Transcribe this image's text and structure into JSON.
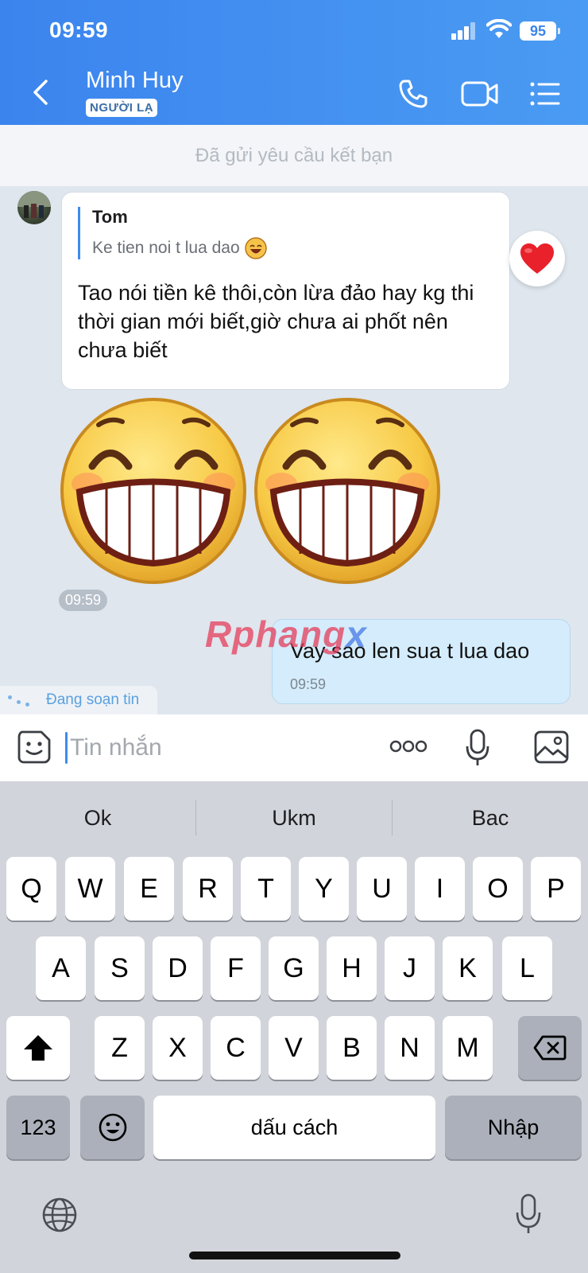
{
  "status_bar": {
    "time": "09:59",
    "battery": "95"
  },
  "header": {
    "contact_name": "Minh Huy",
    "badge": "NGƯỜI LẠ",
    "icons": [
      "back-icon",
      "phone-icon",
      "video-call-icon",
      "menu-list-icon"
    ]
  },
  "friend_banner": "Đã gửi yêu cầu kết bạn",
  "messages": {
    "incoming": {
      "quote_author": "Tom",
      "quote_text": "Ke tien noi t lua dao",
      "text": "Tao nói tiền kê thôi,còn lừa đảo hay kg thi thời gian mới biết,giờ chưa ai phốt nên chưa biết",
      "reaction": "heart-icon",
      "stickers": [
        "grinning-face-sticker",
        "grinning-face-sticker"
      ],
      "time": "09:59"
    },
    "outgoing": {
      "text": "Vay sao len sua t lua dao",
      "time": "09:59"
    }
  },
  "watermark": {
    "part1": "Rphang",
    "part2": "x"
  },
  "typing_indicator": "Đang soạn tin",
  "composer": {
    "placeholder": "Tin nhắn",
    "icons": [
      "sticker-icon",
      "more-icon",
      "microphone-icon",
      "image-icon"
    ]
  },
  "keyboard": {
    "suggestions": [
      "Ok",
      "Ukm",
      "Bac"
    ],
    "row1": [
      "Q",
      "W",
      "E",
      "R",
      "T",
      "Y",
      "U",
      "I",
      "O",
      "P"
    ],
    "row2": [
      "A",
      "S",
      "D",
      "F",
      "G",
      "H",
      "J",
      "K",
      "L"
    ],
    "row3": [
      "Z",
      "X",
      "C",
      "V",
      "B",
      "N",
      "M"
    ],
    "numbers_key": "123",
    "space_key": "dấu cách",
    "enter_key": "Nhập"
  },
  "colors": {
    "header": "#3b84ee",
    "outgoing_bubble": "#d4ecfb",
    "accent": "#3d8bf0"
  }
}
